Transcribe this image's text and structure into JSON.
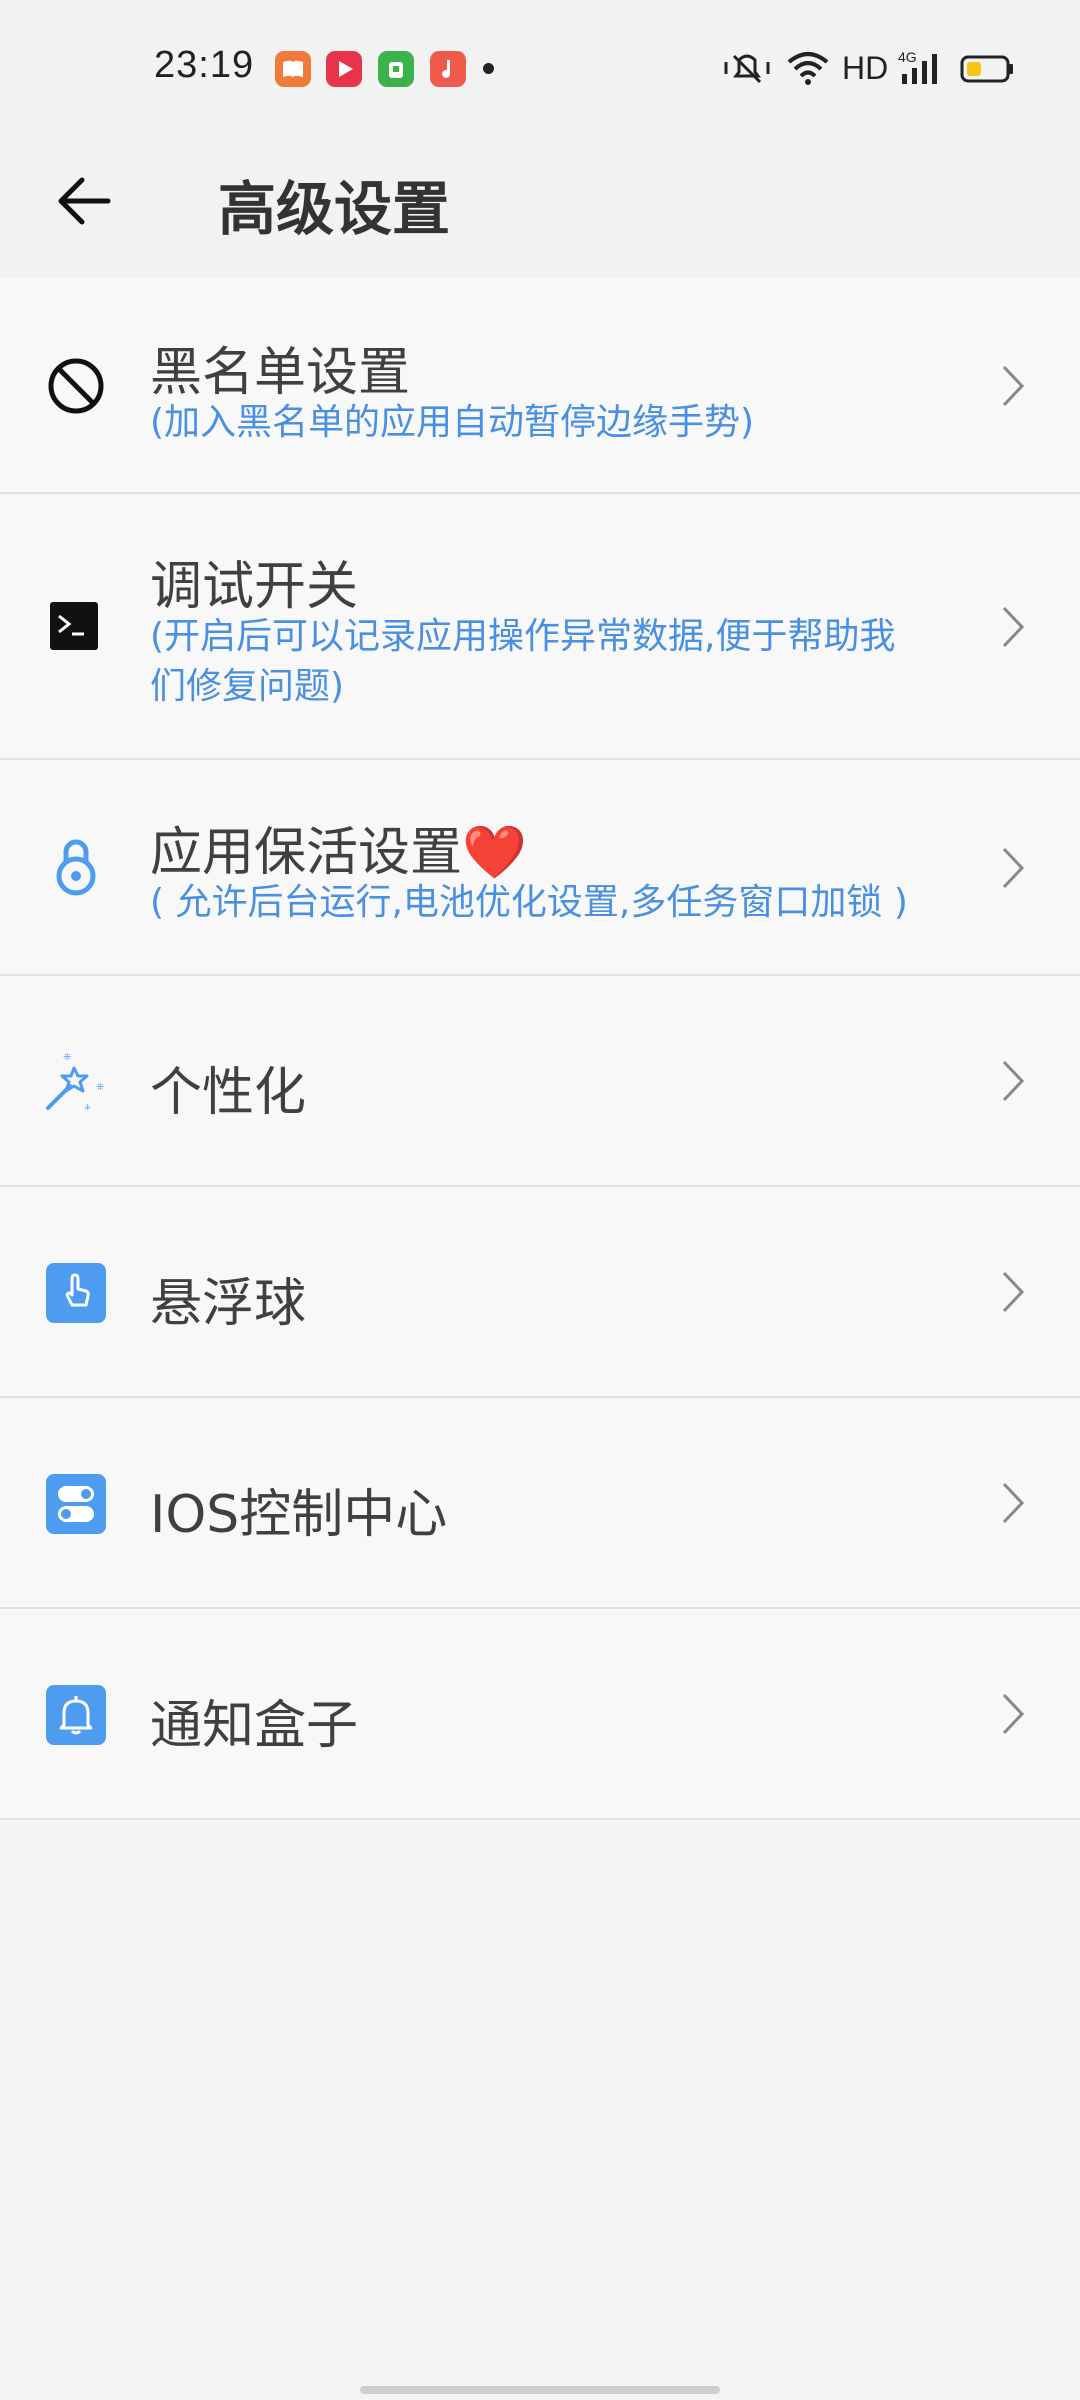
{
  "status_bar": {
    "time": "23:19",
    "network": "HD",
    "apps": [
      "books-app-icon",
      "video-app-icon",
      "shop-app-icon",
      "music-app-icon"
    ],
    "system_icons": [
      "mute-vibrate-icon",
      "wifi-icon",
      "4g-signal-icon",
      "battery-icon"
    ]
  },
  "header": {
    "title": "高级设置",
    "back_icon": "back-arrow-icon"
  },
  "items": [
    {
      "title": "黑名单设置",
      "subtitle": "(加入黑名单的应用自动暂停边缘手势)",
      "icon": "block-icon"
    },
    {
      "title": "调试开关",
      "subtitle": "(开启后可以记录应用操作异常数据,便于帮助我们修复问题)",
      "icon": "terminal-icon"
    },
    {
      "title": "应用保活设置",
      "title_emoji": "❤️",
      "subtitle": "( 允许后台运行,电池优化设置,多任务窗口加锁 )",
      "icon": "lock-icon"
    },
    {
      "title": "个性化",
      "icon": "magic-wand-icon"
    },
    {
      "title": "悬浮球",
      "icon": "touch-icon"
    },
    {
      "title": "IOS控制中心",
      "icon": "toggle-icon"
    },
    {
      "title": "通知盒子",
      "icon": "bell-icon"
    }
  ],
  "colors": {
    "accent": "#4a90e2",
    "icon_blue": "#4d9cf0",
    "heart": "#e0262b",
    "background": "#f8f8f8"
  }
}
